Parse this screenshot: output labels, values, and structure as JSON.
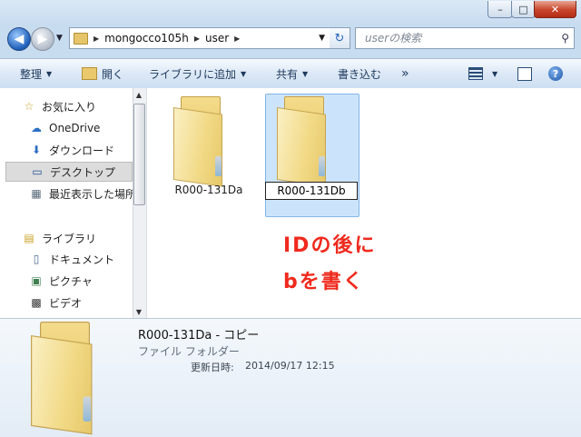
{
  "window": {
    "caption_buttons": {
      "minimize": "–",
      "maximize": "□",
      "close": "✕"
    }
  },
  "nav": {
    "back_glyph": "◀",
    "forward_glyph": "▶",
    "breadcrumbs": [
      "mongocco105h",
      "user"
    ],
    "refresh_glyph": "↻",
    "search_placeholder": "userの検索"
  },
  "toolbar": {
    "organize": "整理",
    "open": "開く",
    "add_to_library": "ライブラリに追加",
    "share": "共有",
    "burn": "書き込む",
    "more": "»",
    "help": "?"
  },
  "sidebar": {
    "items": [
      {
        "label": "お気に入り",
        "icon": "star-icon",
        "glyph": "☆"
      },
      {
        "label": "OneDrive",
        "icon": "cloud-icon",
        "glyph": "☁"
      },
      {
        "label": "ダウンロード",
        "icon": "download-icon",
        "glyph": "⬇"
      },
      {
        "label": "デスクトップ",
        "icon": "desktop-icon",
        "glyph": "▭",
        "selected": true
      },
      {
        "label": "最近表示した場所",
        "icon": "recent-places-icon",
        "glyph": "▦"
      },
      {
        "label": "ライブラリ",
        "icon": "library-icon",
        "glyph": "▤"
      },
      {
        "label": "ドキュメント",
        "icon": "document-icon",
        "glyph": "▯"
      },
      {
        "label": "ピクチャ",
        "icon": "picture-icon",
        "glyph": "▣"
      },
      {
        "label": "ビデオ",
        "icon": "video-icon",
        "glyph": "▩"
      }
    ],
    "scroll_up": "▲",
    "scroll_down": "▼"
  },
  "content": {
    "folders": [
      {
        "name": "R000-131Da"
      },
      {
        "name": "R000-131Db",
        "renaming": true
      }
    ]
  },
  "annotation": {
    "line1": "IDの後に",
    "line2": "bを書く",
    "color": "#ef2a1d"
  },
  "details": {
    "name": "R000-131Da - コピー",
    "type": "ファイル フォルダー",
    "modified_label": "更新日時:",
    "modified_value": "2014/09/17 12:15"
  }
}
